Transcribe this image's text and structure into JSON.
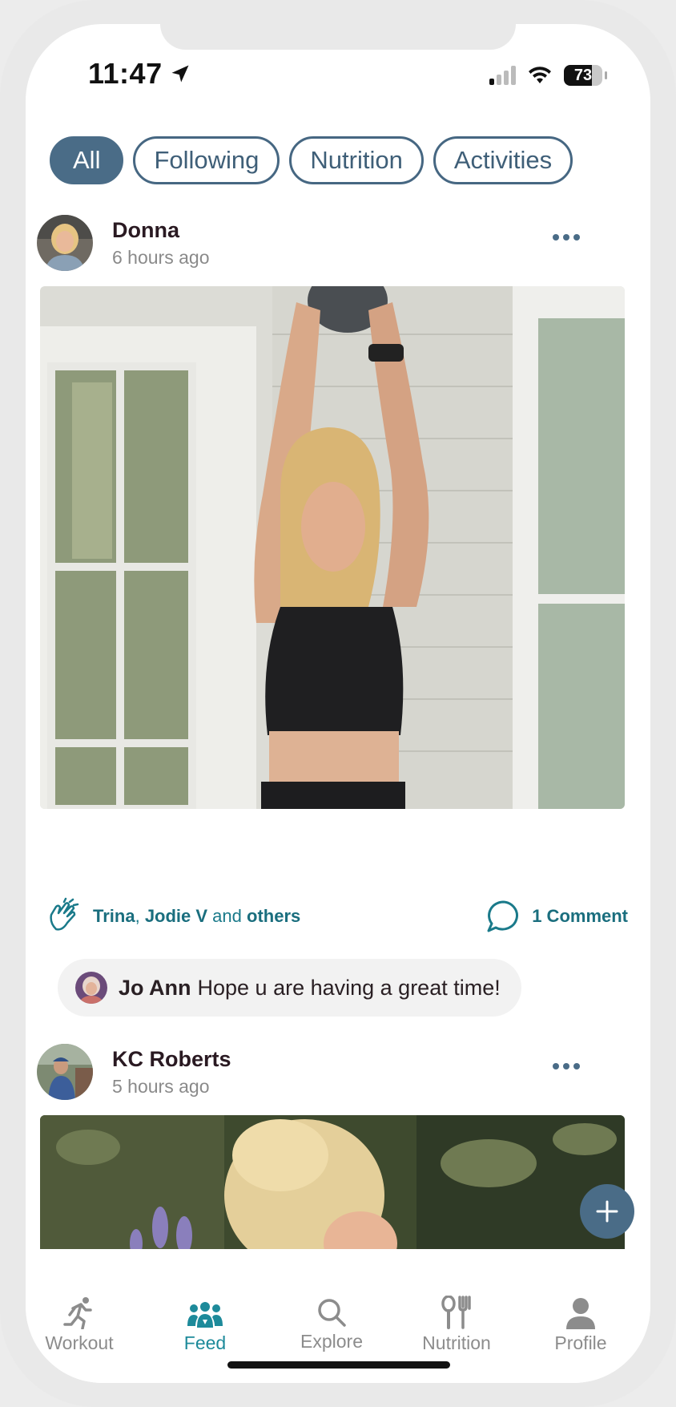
{
  "status": {
    "time": "11:47",
    "battery": "73"
  },
  "filters": [
    {
      "label": "All",
      "active": true
    },
    {
      "label": "Following",
      "active": false
    },
    {
      "label": "Nutrition",
      "active": false
    },
    {
      "label": "Activities",
      "active": false
    }
  ],
  "posts": [
    {
      "author": "Donna",
      "time": "6 hours ago",
      "reactions": {
        "name1": "Trina",
        "sep1": ", ",
        "name2": "Jodie V",
        "sep2": " and ",
        "others": "others"
      },
      "comment_count": "1 Comment",
      "comment": {
        "author": "Jo Ann",
        "text": "Hope u are having a great time!"
      }
    },
    {
      "author": "KC Roberts",
      "time": "5 hours ago"
    }
  ],
  "tabs": [
    {
      "label": "Workout",
      "icon": "running-icon"
    },
    {
      "label": "Feed",
      "icon": "group-icon"
    },
    {
      "label": "Explore",
      "icon": "search-icon"
    },
    {
      "label": "Nutrition",
      "icon": "fork-knife-icon"
    },
    {
      "label": "Profile",
      "icon": "person-icon"
    }
  ],
  "colors": {
    "accent": "#4a6c87",
    "active_tab": "#1d8a9a",
    "link": "#1a6e7e"
  }
}
